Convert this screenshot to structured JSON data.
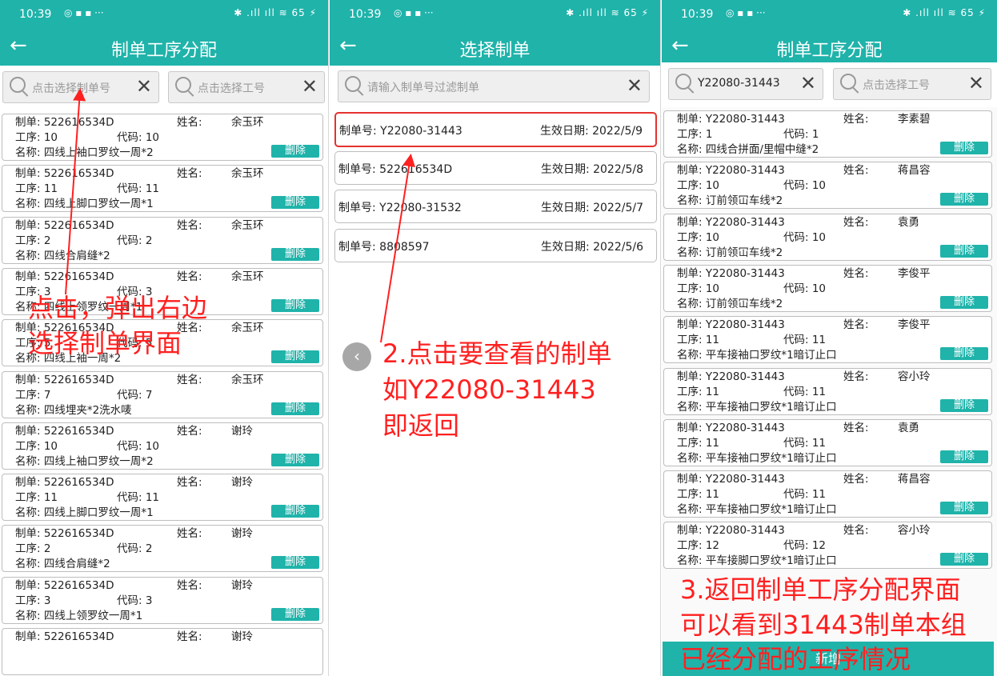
{
  "status_bar": {
    "time": "10:39",
    "left_icons": "◎ ▪ ▪ ···",
    "right_icons": "✱ .ıll ıll ≋ 65 ⚡"
  },
  "screen1": {
    "title": "制单工序分配",
    "search_order_placeholder": "点击选择制单号",
    "search_process_placeholder": "点击选择工号",
    "delete_label": "删除",
    "cards": [
      {
        "order": "制单: 522616534D",
        "name_label": "姓名:",
        "name": "余玉环",
        "process": "工序: 10",
        "code": "代码: 10",
        "title": "名称: 四线上袖口罗纹一周*2"
      },
      {
        "order": "制单: 522616534D",
        "name_label": "姓名:",
        "name": "余玉环",
        "process": "工序: 11",
        "code": "代码: 11",
        "title": "名称: 四线上脚口罗纹一周*1"
      },
      {
        "order": "制单: 522616534D",
        "name_label": "姓名:",
        "name": "余玉环",
        "process": "工序: 2",
        "code": "代码: 2",
        "title": "名称: 四线合肩缝*2"
      },
      {
        "order": "制单: 522616534D",
        "name_label": "姓名:",
        "name": "余玉环",
        "process": "工序: 3",
        "code": "代码: 3",
        "title": "名称: 四线上领罗纹一周*1"
      },
      {
        "order": "制单: 522616534D",
        "name_label": "姓名:",
        "name": "余玉环",
        "process": "工序: 5",
        "code": "代码: 5",
        "title": "名称: 四线上袖一周*2"
      },
      {
        "order": "制单: 522616534D",
        "name_label": "姓名:",
        "name": "余玉环",
        "process": "工序: 7",
        "code": "代码: 7",
        "title": "名称: 四线埋夹*2洗水唛"
      },
      {
        "order": "制单: 522616534D",
        "name_label": "姓名:",
        "name": "谢玲",
        "process": "工序: 10",
        "code": "代码: 10",
        "title": "名称: 四线上袖口罗纹一周*2"
      },
      {
        "order": "制单: 522616534D",
        "name_label": "姓名:",
        "name": "谢玲",
        "process": "工序: 11",
        "code": "代码: 11",
        "title": "名称: 四线上脚口罗纹一周*1"
      },
      {
        "order": "制单: 522616534D",
        "name_label": "姓名:",
        "name": "谢玲",
        "process": "工序: 2",
        "code": "代码: 2",
        "title": "名称: 四线合肩缝*2"
      },
      {
        "order": "制单: 522616534D",
        "name_label": "姓名:",
        "name": "谢玲",
        "process": "工序: 3",
        "code": "代码: 3",
        "title": "名称: 四线上领罗纹一周*1"
      },
      {
        "order": "制单: 522616534D",
        "name_label": "姓名:",
        "name": "谢玲",
        "process": "",
        "code": "",
        "title": ""
      }
    ]
  },
  "screen2": {
    "title": "选择制单",
    "filter_placeholder": "请输入制单号过滤制单",
    "orders": [
      {
        "number": "制单号: Y22080-31443",
        "date": "生效日期: 2022/5/9"
      },
      {
        "number": "制单号: 522616534D",
        "date": "生效日期: 2022/5/8"
      },
      {
        "number": "制单号: Y22080-31532",
        "date": "生效日期: 2022/5/7"
      },
      {
        "number": "制单号: 8808597",
        "date": "生效日期: 2022/5/6"
      }
    ]
  },
  "screen3": {
    "title": "制单工序分配",
    "search_order_value": "Y22080-31443",
    "search_process_placeholder": "点击选择工号",
    "delete_label": "删除",
    "add_label": "新增",
    "cards": [
      {
        "order": "制单: Y22080-31443",
        "name_label": "姓名:",
        "name": "李素碧",
        "process": "工序: 1",
        "code": "代码: 1",
        "title": "名称: 四线合拼面/里帽中缝*2"
      },
      {
        "order": "制单: Y22080-31443",
        "name_label": "姓名:",
        "name": "蒋昌容",
        "process": "工序: 10",
        "code": "代码: 10",
        "title": "名称: 订前领冚车线*2"
      },
      {
        "order": "制单: Y22080-31443",
        "name_label": "姓名:",
        "name": "袁勇",
        "process": "工序: 10",
        "code": "代码: 10",
        "title": "名称: 订前领冚车线*2"
      },
      {
        "order": "制单: Y22080-31443",
        "name_label": "姓名:",
        "name": "李俊平",
        "process": "工序: 10",
        "code": "代码: 10",
        "title": "名称: 订前领冚车线*2"
      },
      {
        "order": "制单: Y22080-31443",
        "name_label": "姓名:",
        "name": "李俊平",
        "process": "工序: 11",
        "code": "代码: 11",
        "title": "名称: 平车接袖口罗纹*1暗订止口"
      },
      {
        "order": "制单: Y22080-31443",
        "name_label": "姓名:",
        "name": "容小玲",
        "process": "工序: 11",
        "code": "代码: 11",
        "title": "名称: 平车接袖口罗纹*1暗订止口"
      },
      {
        "order": "制单: Y22080-31443",
        "name_label": "姓名:",
        "name": "袁勇",
        "process": "工序: 11",
        "code": "代码: 11",
        "title": "名称: 平车接袖口罗纹*1暗订止口"
      },
      {
        "order": "制单: Y22080-31443",
        "name_label": "姓名:",
        "name": "蒋昌容",
        "process": "工序: 11",
        "code": "代码: 11",
        "title": "名称: 平车接袖口罗纹*1暗订止口"
      },
      {
        "order": "制单: Y22080-31443",
        "name_label": "姓名:",
        "name": "容小玲",
        "process": "工序: 12",
        "code": "代码: 12",
        "title": "名称: 平车接脚口罗纹*1暗订止口"
      }
    ]
  },
  "annotations": {
    "a1_line1": "点击，弹出右边",
    "a1_line2": "选择制单界面",
    "a2_line1": "2.点击要查看的制单",
    "a2_line2": "如Y22080-31443",
    "a2_line3": "即返回",
    "a3_line1": "3.返回制单工序分配界面",
    "a3_line2": "可以看到31443制单本组",
    "a3_line3": "已经分配的工序情况"
  },
  "colors": {
    "teal": "#1fb3aa",
    "annotation_red": "#ff2020"
  }
}
